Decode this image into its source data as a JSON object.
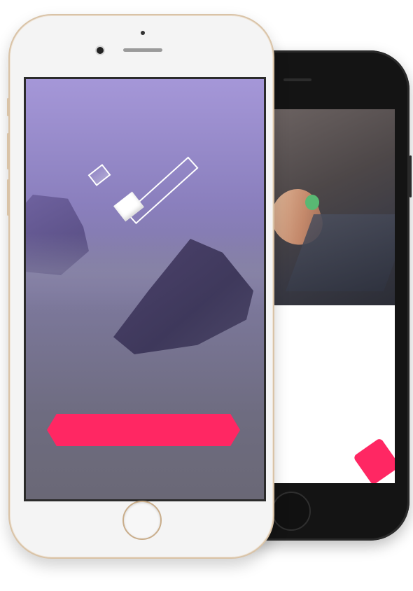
{
  "front_phone": {
    "screen": {
      "logo": {
        "icon": "toggle-logo-icon"
      },
      "cta_button": {
        "label": "",
        "color": "#ff2763"
      }
    },
    "home_button": {
      "icon": "home-button"
    },
    "frame_color": "#d9c3a7",
    "screen_gradient_top": "#a597d8",
    "screen_gradient_bottom": "#6a6876"
  },
  "back_phone": {
    "frame_color": "#141414",
    "accent_color": "#ff2763",
    "accent_icon": "pink-shape-icon"
  }
}
